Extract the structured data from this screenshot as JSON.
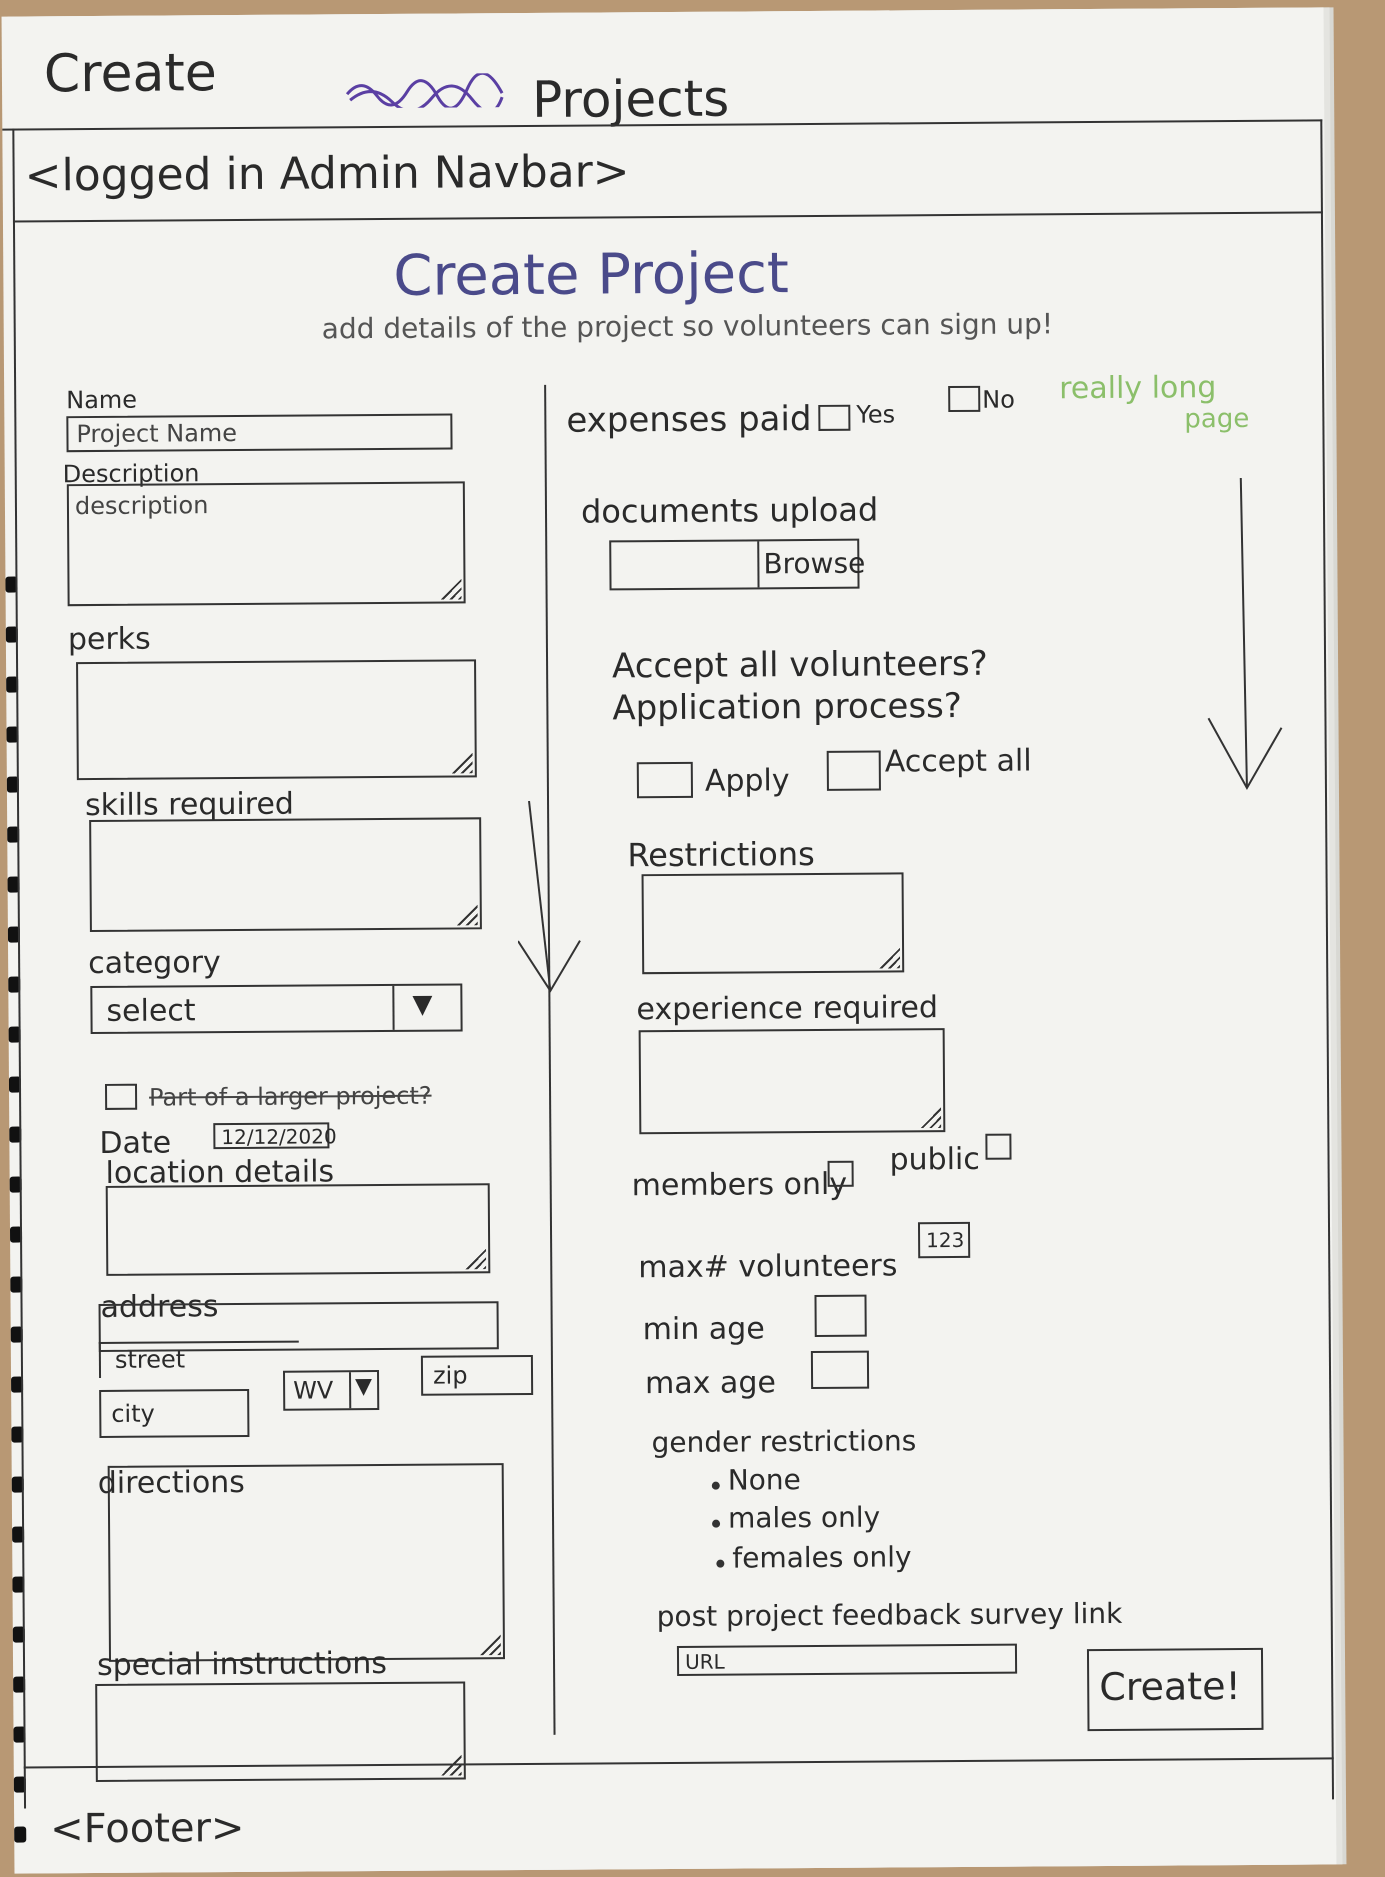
{
  "header": {
    "create_word": "Create",
    "projects_word": "Projects"
  },
  "navbar": {
    "label": "<logged in Admin Navbar>"
  },
  "title": "Create Project",
  "subtitle": "add details of the project so volunteers can sign up!",
  "side_note": {
    "line1": "really long",
    "line2": "page"
  },
  "left": {
    "name_label": "Name",
    "name_placeholder": "Project Name",
    "description_label": "Description",
    "description_placeholder": "description",
    "perks_label": "perks",
    "skills_label": "skills required",
    "category_label": "category",
    "category_select": "select",
    "larger_project": "Part of a larger project?",
    "date_label": "Date",
    "date_value": "12/12/2020",
    "location_label": "location details",
    "address_label": "address",
    "street_placeholder": "street",
    "city_placeholder": "city",
    "state_value": "WV",
    "zip_placeholder": "zip",
    "directions_label": "directions",
    "special_label": "special instructions"
  },
  "right": {
    "expenses_label": "expenses paid",
    "yes_label": "Yes",
    "no_label": "No",
    "documents_label": "documents upload",
    "browse_label": "Browse",
    "accept_q1": "Accept all volunteers?",
    "accept_q2": "Application process?",
    "apply_label": "Apply",
    "accept_all_label": "Accept all",
    "restrictions_label": "Restrictions",
    "experience_label": "experience required",
    "members_label": "members only",
    "public_label": "public",
    "max_vol_label": "max# volunteers",
    "max_vol_value": "123",
    "min_age_label": "min age",
    "max_age_label": "max age",
    "gender_label": "gender restrictions",
    "gender_options": [
      "None",
      "males only",
      "females only"
    ],
    "feedback_label": "post project feedback survey link",
    "url_placeholder": "URL",
    "create_label": "Create!"
  },
  "footer": {
    "label": "<Footer>"
  },
  "colors": {
    "ink": "#2a2a2a",
    "purple": "#5a3fa3",
    "green": "#8bbf6a"
  }
}
